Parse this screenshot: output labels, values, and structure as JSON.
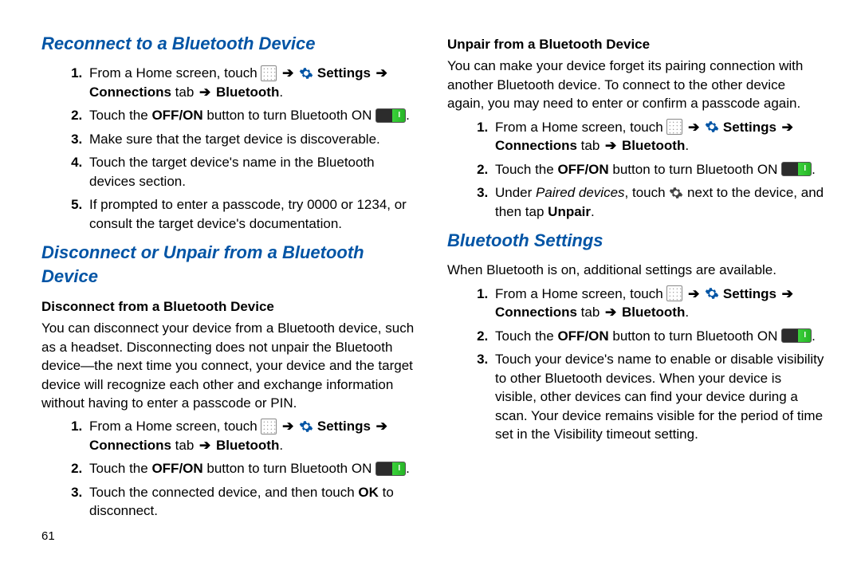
{
  "col1": {
    "h_reconnect": "Reconnect to a Bluetooth Device",
    "reconnect_steps": {
      "s1a": "From a Home screen, touch ",
      "s1_settings": " Settings ",
      "s1_conn": "Connections",
      "s1_tab": " tab ",
      "s1_bt": " Bluetooth",
      "s2a": "Touch the ",
      "s2_offon": "OFF/ON",
      "s2b": " button to turn Bluetooth ON ",
      "s3": "Make sure that the target device is discoverable.",
      "s4": "Touch the target device's name in the Bluetooth devices section.",
      "s5": "If prompted to enter a passcode, try 0000 or 1234, or consult the target device's documentation."
    },
    "h_disc_unpair": "Disconnect or Unpair from a Bluetooth Device",
    "sub_disconnect": "Disconnect from a Bluetooth Device",
    "disc_para": "You can disconnect your device from a Bluetooth device, such as a headset. Disconnecting does not unpair the Bluetooth device—the next time you connect, your device and the target device will recognize each other and exchange information without having to enter a passcode or PIN.",
    "disc_steps": {
      "s3a": "Touch the connected device, and then touch ",
      "s3_ok": "OK",
      "s3b": " to disconnect."
    },
    "page_num": "61"
  },
  "col2": {
    "sub_unpair": "Unpair from a Bluetooth Device",
    "unpair_para": "You can make your device forget its pairing connection with another Bluetooth device. To connect to the other device again, you may need to enter or confirm a passcode again.",
    "unpair_steps": {
      "s3a": "Under ",
      "s3_pd": "Paired devices",
      "s3b": ", touch ",
      "s3c": " next to the device, and then tap ",
      "s3_unpair": "Unpair"
    },
    "h_btsettings": "Bluetooth Settings",
    "bts_para": "When Bluetooth is on, additional settings are available.",
    "bts_steps": {
      "s3": "Touch your device's name to enable or disable visibility to other Bluetooth devices. When your device is visible, other devices can find your device during a scan. Your device remains visible for the period of time set in the Visibility timeout setting."
    }
  },
  "common": {
    "arrow": "➔",
    "period": "."
  }
}
